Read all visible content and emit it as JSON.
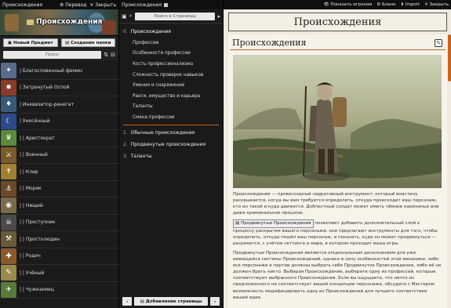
{
  "left": {
    "header": "Происхождения",
    "header_actions": [
      "Перевод",
      "Закрыть"
    ],
    "banner_title": "Происхождения",
    "new_item": "Новый Предмет",
    "new_folder": "Создание папки",
    "search_placeholder": "Поиск",
    "items": [
      "| Благословенный фемин",
      "| Затронутый Оспой",
      "| Инквизитор-ренегат",
      "| Унесённый",
      "| | Аристократ",
      "| | Военный",
      "| | Клир",
      "| | Моряк",
      "| | Нищий",
      "| | Преступник",
      "| | Простолюдин",
      "| | Родич",
      "| | Учёный",
      "| | Чужеземец"
    ]
  },
  "mid": {
    "header": "Происхождения",
    "search_placeholder": "Поиск в Страницы",
    "toc": {
      "active_num": "0.",
      "active_label": "Происхождения",
      "subs": [
        "Профессии",
        "Особенности профессии",
        "Кость профессионализма",
        "Сложность проверок навыков",
        "Умения и снаряжение",
        "Ранги, имущество и карьера",
        "Таланты",
        "Смена профессии"
      ],
      "sections": [
        {
          "num": "1.",
          "label": "Обычные происхождения"
        },
        {
          "num": "2.",
          "label": "Продвинутые происхождения"
        },
        {
          "num": "3.",
          "label": "Таланты"
        }
      ]
    },
    "add_page": "Добавление страницы"
  },
  "right": {
    "header_actions": [
      "Показать игрокам",
      "Бланк",
      "Import",
      "Закрыть"
    ],
    "page_title": "Происхождения",
    "section_title": "Происхождения",
    "para1": "Происхождение — превосходный нарративный инструмент, который воистину раскрывается, когда вы вам требуется определить, откуда происходит ваш персонаж, кто он такой и куда движется. Доблестный солдат может иметь тёмное наемничье или даже криминальное прошлое.",
    "link_text": "Продвинутые Происхождения",
    "para2_rest": "позволяют добавить дополнительный слой к процессу раскрытия вашего персонажа: они предлагают инструменты для того, чтобы определить, откуда пошёл ваш персонаж, и показать, куда он может продвинуться — разумеется, с учётом сеттинга и мира, в котором проходит ваша игры.",
    "para3": "Продвинутые Происхождения являются опциональным дополнением для уже имеющейся системы Происхождений, однако в силу особенностей этой механики, либо все персонажи в партии должны выбрать себе Продвинутое Происхождение, либо её не должен брать никто. Выбирая Происхождение, выберите одну из профессий, которые соответствуют выбранного Происхождения. Если вы ощущаете, что ничто из предложенного не соответствует вашей концепции персонажа, обсудите с Мастером возможность модифицировать одну из Происхождений для лучшего соответствия вашей идее."
  },
  "colors": {
    "accent": "#c8621e"
  }
}
